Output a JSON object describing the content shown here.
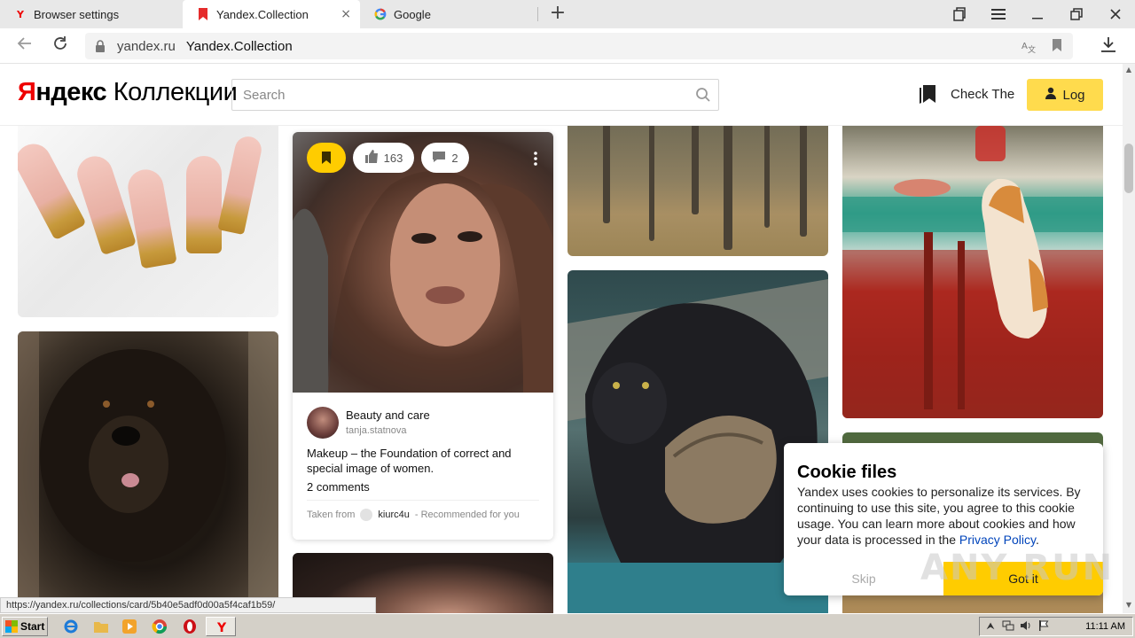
{
  "browser": {
    "tabs": [
      {
        "label": "Browser settings",
        "favicon": "yandex-y-icon",
        "active": false
      },
      {
        "label": "Yandex.Collection",
        "favicon": "bookmark-red-icon",
        "active": true
      },
      {
        "label": "Google",
        "favicon": "google-g-icon",
        "active": false
      }
    ],
    "close_glyph": "×",
    "new_tab_glyph": "+",
    "address": {
      "domain": "yandex.ru",
      "title": "Yandex.Collection"
    }
  },
  "header": {
    "logo": {
      "part1": "Я",
      "part2": "ндекс",
      "part3": " Коллекции"
    },
    "search_placeholder": "Search",
    "check_label": "Check The",
    "login_label": "Log"
  },
  "featured_card": {
    "likes": "163",
    "comments_count": "2",
    "board": "Beauty and care",
    "author": "tanja.statnova",
    "description": "Makeup – the Foundation of correct and special image of women.",
    "comments_label": "2 comments",
    "source_prefix": "Taken from",
    "source_user": "kiurc4u",
    "source_suffix": "- Recommended for you"
  },
  "cookie": {
    "title": "Cookie files",
    "text": "Yandex uses cookies to personalize its services. By continuing to use this site, you agree to this cookie usage. You can learn more about cookies and how your data is processed in the",
    "link": "Privacy Policy",
    "period": ".",
    "skip": "Skip",
    "accept": "Got it"
  },
  "status_url": "https://yandex.ru/collections/card/5b40e5adf0d00a5f4caf1b59/",
  "taskbar": {
    "start": "Start",
    "clock": "11:11 AM"
  },
  "watermark": "ANY RUN",
  "colors": {
    "accent_yellow": "#ffcc00",
    "login_yellow": "#ffdb4d",
    "logo_red": "#ee0000",
    "link_blue": "#0044bb"
  }
}
